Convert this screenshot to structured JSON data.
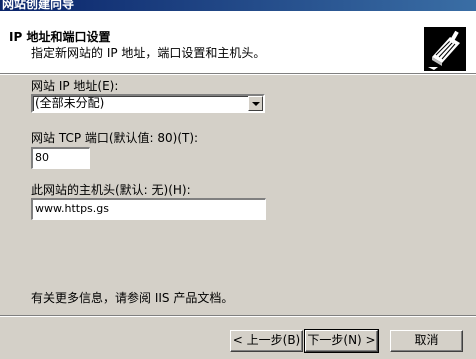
{
  "window": {
    "title": "网站创建向导"
  },
  "header": {
    "title": "IP 地址和端口设置",
    "subtitle": "指定新网站的 IP 地址，端口设置和主机头。",
    "icon": "wizard-book-icon"
  },
  "ip": {
    "label": "网站 IP 地址(E):",
    "value": "(全部未分配)"
  },
  "tcp": {
    "label": "网站 TCP 端口(默认值: 80)(T):",
    "value": "80"
  },
  "host": {
    "label": "此网站的主机头(默认: 无)(H):",
    "value": "www.https.gs"
  },
  "info": "有关更多信息，请参阅 IIS 产品文档。",
  "buttons": {
    "back": "< 上一步(B)",
    "next": "下一步(N) >",
    "cancel": "取消"
  },
  "colors": {
    "title_bar": "#0a246a",
    "face": "#d4d0c8",
    "header_bg": "#ffffff"
  }
}
